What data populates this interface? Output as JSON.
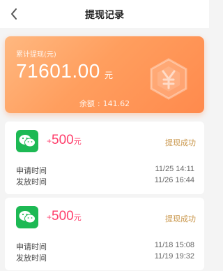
{
  "header": {
    "title": "提现记录"
  },
  "summary": {
    "label": "累计提现(元)",
    "total": "71601.00",
    "unit": "元",
    "balance_label": "余额",
    "balance_sep": ":",
    "balance_value": "141.62"
  },
  "records": [
    {
      "plus": "+",
      "amount": "500",
      "unit": "元",
      "status": "提现成功",
      "apply_label": "申请时间",
      "apply_time": "11/25 14:11",
      "issue_label": "发放时间",
      "issue_time": "11/26 16:44"
    },
    {
      "plus": "+",
      "amount": "500",
      "unit": "元",
      "status": "提现成功",
      "apply_label": "申请时间",
      "apply_time": "11/18 15:08",
      "issue_label": "发放时间",
      "issue_time": "11/19 19:32"
    }
  ],
  "colors": {
    "accent": "#ff9e5e",
    "amount": "#ff3f6c",
    "status": "#c9964a",
    "wechat": "#1db954"
  },
  "icons": {
    "back": "chevron-left-icon",
    "currency": "yen-icon",
    "payment": "wechat-icon"
  }
}
